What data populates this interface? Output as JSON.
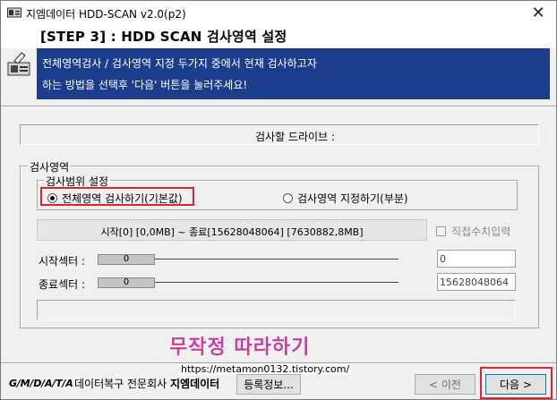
{
  "window": {
    "title": "지엠데이터 HDD-SCAN v2.0(p2)",
    "close_glyph": "✕"
  },
  "header": {
    "step_title": "[STEP 3] : HDD SCAN 검사영역 설정",
    "info_line1": "전체영역검사 / 검사영역 지정 두가지 중에서 현재 검사하고자",
    "info_line2": "하는 방법을 선택후 '다음' 버튼을 눌러주세요!"
  },
  "drive": {
    "label": "검사할 드라이브 :"
  },
  "scan_area": {
    "group_title": "검사영역",
    "range_group_title": "검사범위 설정",
    "option_full": "전체영역 검사하기(기본값)",
    "option_custom": "검사영역 지정하기(부분)",
    "selected": "full",
    "range_text": "시작[0] [0,0MB] ~ 종료[15628048064] [7630882,8MB]",
    "direct_input_label": "직접수치입력",
    "start_label": "시작섹터 :",
    "start_thumb": "0",
    "start_value": "0",
    "end_label": "종료섹터 :",
    "end_thumb": "0",
    "end_value": "15628048064"
  },
  "footer": {
    "logo": "G/M/D/A/T/A",
    "company_prefix": "데이터복구 전문회사",
    "company_name": "지엠데이터",
    "register_button": "등록정보...",
    "prev_button": "< 이전",
    "next_button": "다음 >"
  },
  "watermark": {
    "title": "무작정 따라하기",
    "url": "https://metamon0132.tistory.com/"
  },
  "colors": {
    "info_band": "#1c3c8c",
    "highlight": "#e0242b",
    "watermark": "#c93d9b"
  }
}
